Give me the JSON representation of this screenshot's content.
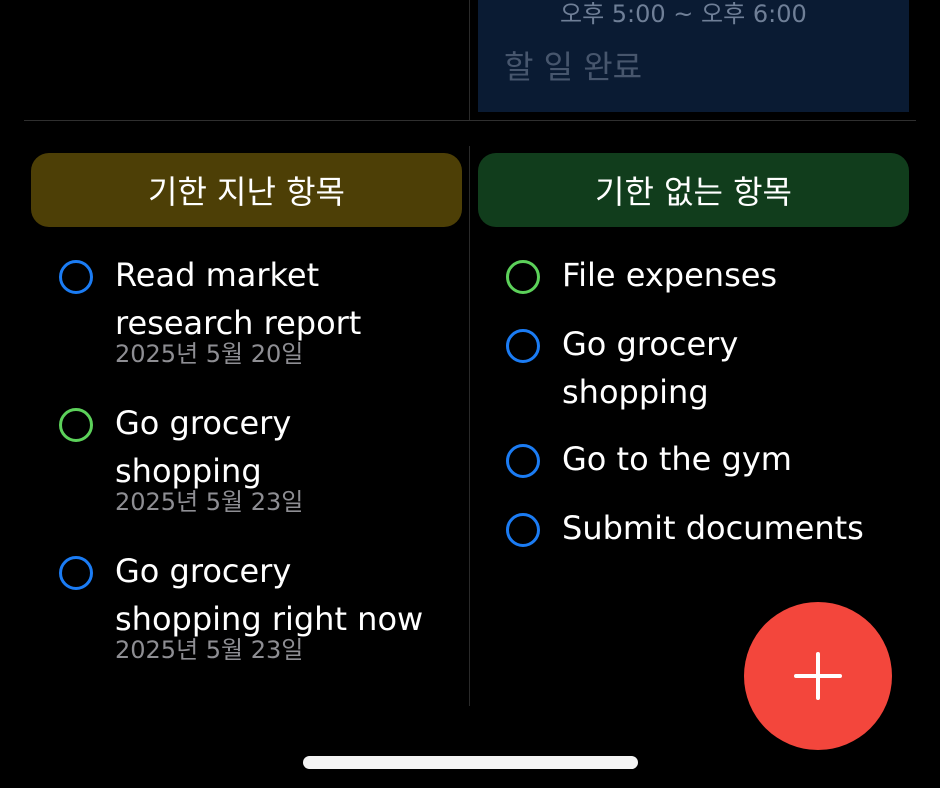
{
  "top_card": {
    "time_range": "오후 5:00 ~ 오후 6:00",
    "action": "할 일 완료"
  },
  "overdue": {
    "header": "기한 지난 항목",
    "tasks": [
      {
        "title": "Read market research report",
        "date": "2025년 5월 20일",
        "status": "blue"
      },
      {
        "title": "Go grocery shopping",
        "date": "2025년 5월 23일",
        "status": "green"
      },
      {
        "title": "Go grocery shopping right now",
        "date": "2025년 5월 23일",
        "status": "blue"
      }
    ]
  },
  "no_due": {
    "header": "기한 없는 항목",
    "tasks": [
      {
        "title": "File expenses",
        "status": "green"
      },
      {
        "title": "Go grocery shopping",
        "status": "blue"
      },
      {
        "title": "Go to the gym",
        "status": "blue"
      },
      {
        "title": "Submit documents",
        "status": "blue"
      }
    ]
  },
  "fab": {
    "icon": "plus-icon"
  },
  "colors": {
    "background": "#000000",
    "overdue_header": "#4d3f06",
    "nodue_header": "#113d1c",
    "circle_blue": "#1b7cf4",
    "circle_green": "#5cd15a",
    "fab": "#f3463c",
    "date_text": "#8e8e93"
  }
}
